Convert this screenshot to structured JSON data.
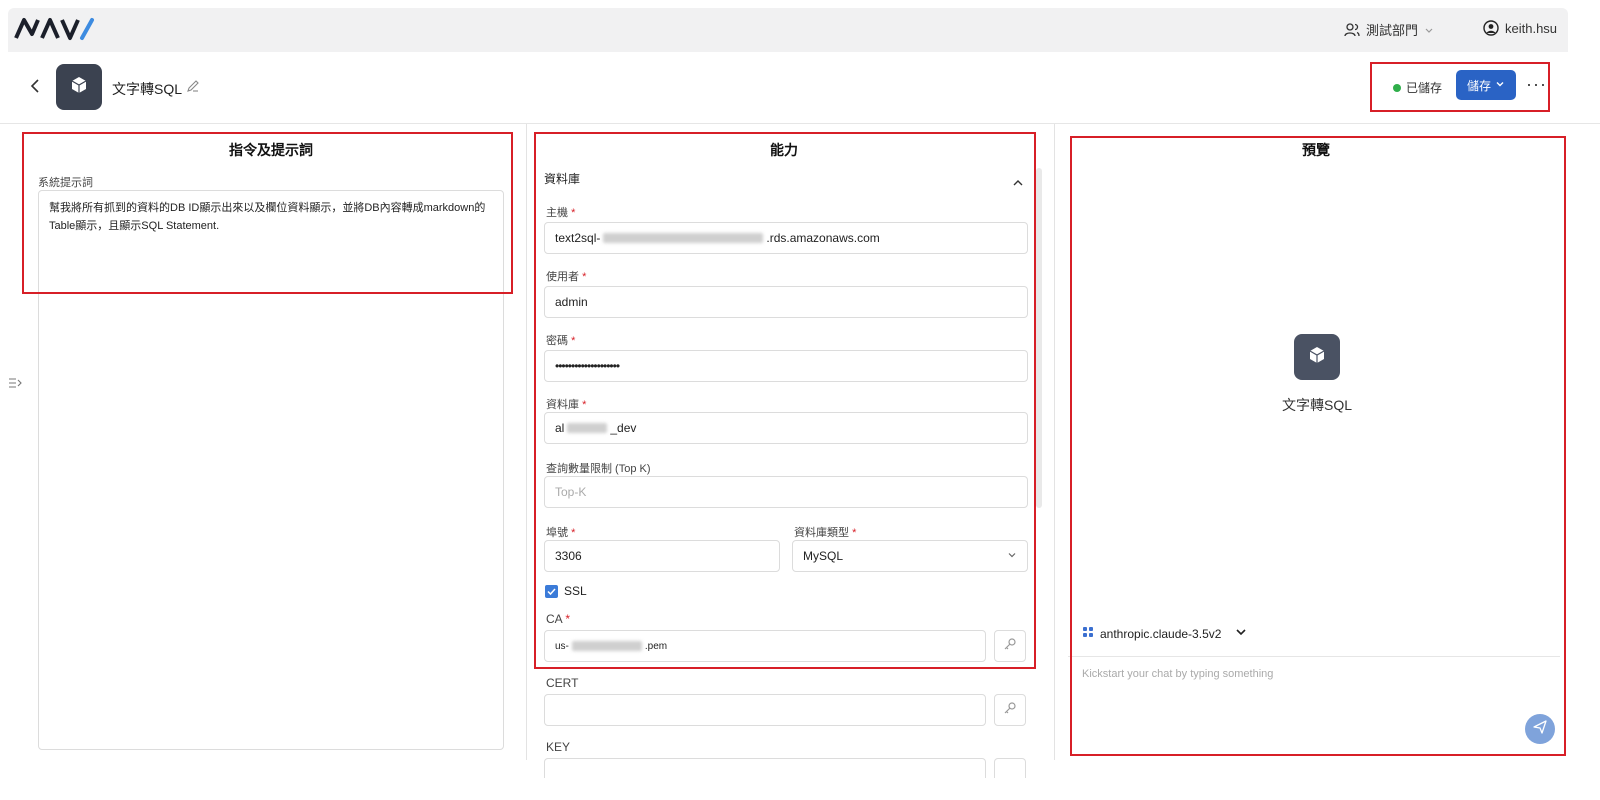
{
  "topbar": {
    "logo_text": "NAVI",
    "department": "測試部門",
    "username": "keith.hsu"
  },
  "header": {
    "app_title": "文字轉SQL",
    "status": "已儲存",
    "save_label": "儲存",
    "more": "···"
  },
  "instructions": {
    "title": "指令及提示詞",
    "system_prompt_label": "系統提示詞",
    "system_prompt": "幫我將所有抓到的資料的DB ID顯示出來以及欄位資料顯示，並將DB內容轉成markdown的Table顯示，且顯示SQL Statement."
  },
  "capabilities": {
    "title": "能力",
    "section": "資料庫",
    "host_label": "主機",
    "host_prefix": "text2sql-",
    "host_suffix": ".rds.amazonaws.com",
    "user_label": "使用者",
    "user_value": "admin",
    "password_label": "密碼",
    "password_value": "••••••••••••••••••••",
    "database_label": "資料庫",
    "database_prefix": "al",
    "database_suffix": "_dev",
    "topk_label": "查詢數量限制 (Top K)",
    "topk_placeholder": "Top-K",
    "port_label": "埠號",
    "port_value": "3306",
    "dbtype_label": "資料庫類型",
    "dbtype_value": "MySQL",
    "ssl_label": "SSL",
    "ca_label": "CA",
    "ca_prefix": "us-",
    "ca_suffix": ".pem",
    "cert_label": "CERT",
    "key_label": "KEY",
    "required_mark": "*"
  },
  "preview": {
    "title": "預覽",
    "app_title": "文字轉SQL",
    "model": "anthropic.claude-3.5v2",
    "chat_placeholder": "Kickstart your chat by typing something"
  },
  "colors": {
    "accent": "#2a63c5",
    "highlight": "#d71f27",
    "status_ok": "#2fae4a"
  },
  "icons": [
    "user-group-icon",
    "chevron-down-icon",
    "user-circle-icon",
    "back-arrow-icon",
    "cube-icon",
    "edit-icon",
    "chevron-up-icon",
    "key-icon",
    "model-grid-icon",
    "send-icon",
    "sidebar-expand-icon"
  ]
}
